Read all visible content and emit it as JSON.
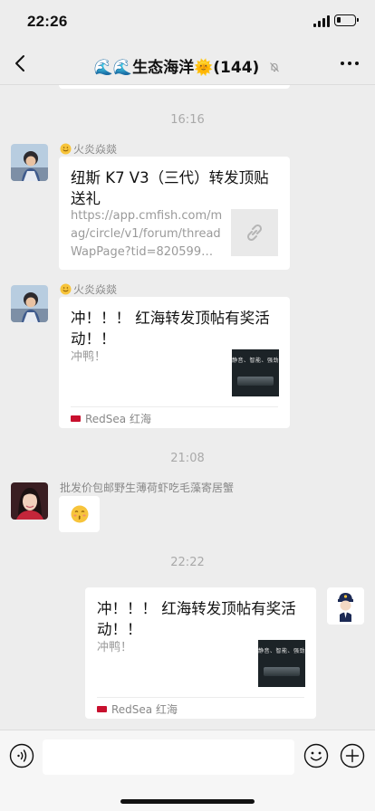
{
  "status_bar": {
    "time": "22:26",
    "battery_level": 0.25
  },
  "header": {
    "title": "🌊🌊生态海洋🌞(144)"
  },
  "messages": [
    {
      "type": "time",
      "text": "16:16"
    },
    {
      "type": "link",
      "sender": "火炎焱燚",
      "title": "纽斯 K7 V3（三代）转发顶贴送礼",
      "description": "https://app.cmfish.com/mag/circle/v1/forum/threadWapPage?tid=820599…",
      "thumbnail_icon": "link-icon"
    },
    {
      "type": "link",
      "sender": "火炎焱燚",
      "title": "冲！！！ 红海转发顶帖有奖活动！！",
      "description": "冲鸭！",
      "thumbnail_text": "静音、智能、强劲",
      "source": "RedSea 红海"
    },
    {
      "type": "time",
      "text": "21:08"
    },
    {
      "type": "sticker",
      "sender": "批发价包邮野生薄荷虾吃毛藻寄居蟹",
      "sticker_icon": "kissing-face-emoji"
    },
    {
      "type": "time",
      "text": "22:22"
    },
    {
      "type": "link",
      "sender": "self",
      "title": "冲！！！ 红海转发顶帖有奖活动！！",
      "description": "冲鸭！",
      "thumbnail_text": "静音、智能、强劲",
      "source": "RedSea 红海"
    }
  ],
  "input_bar": {
    "voice_icon": "voice-icon",
    "emoji_icon": "emoji-icon",
    "plus_icon": "plus-icon"
  },
  "colors": {
    "background": "#ededed",
    "bubble": "#ffffff",
    "timestamp": "#a9a9a9"
  }
}
